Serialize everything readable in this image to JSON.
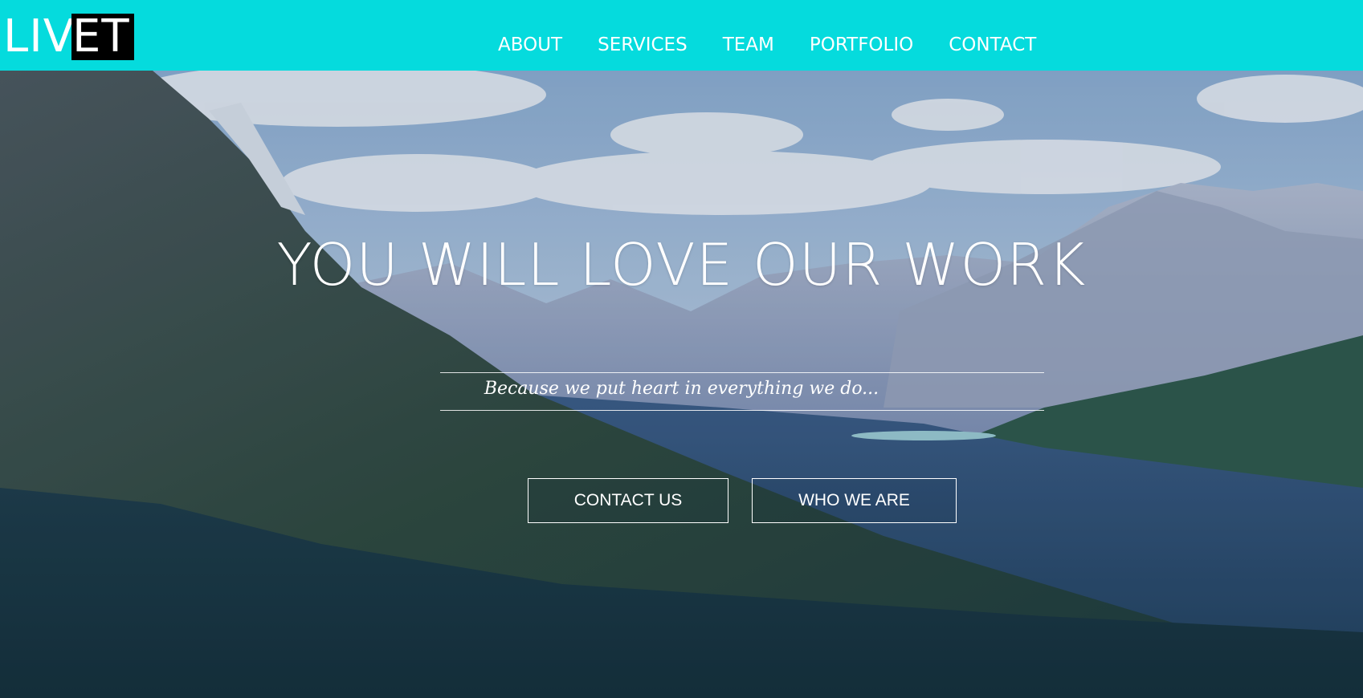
{
  "brand": {
    "logo_left": "LIV",
    "logo_box": "ET"
  },
  "nav": {
    "items": [
      {
        "label": "ABOUT"
      },
      {
        "label": "SERVICES"
      },
      {
        "label": "TEAM"
      },
      {
        "label": "PORTFOLIO"
      },
      {
        "label": "CONTACT"
      }
    ]
  },
  "hero": {
    "title": "YOU WILL LOVE OUR WORK",
    "tagline": "Because we put heart in everything we do...",
    "buttons": {
      "contact": "CONTACT US",
      "who": "WHO WE ARE"
    },
    "background": "mountain-valley-photo"
  },
  "colors": {
    "navbar": "#05dbdd",
    "logo_box": "#000000",
    "text": "#ffffff"
  }
}
